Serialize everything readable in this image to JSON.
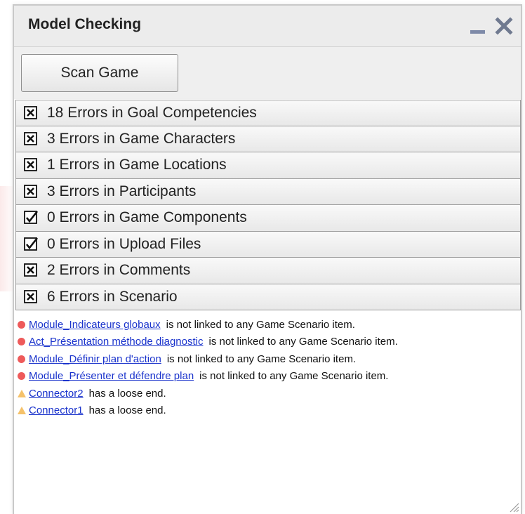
{
  "window": {
    "title": "Model Checking",
    "minimize_icon": "minimize-icon",
    "close_icon": "close-icon"
  },
  "toolbar": {
    "scan_label": "Scan Game"
  },
  "colors": {
    "error_dot": "#ee5a5a",
    "warning_triangle": "#f5c26b",
    "link": "#1a33cc",
    "section_bg": "#efefef"
  },
  "sections": [
    {
      "label": "18 Errors in Goal Competencies",
      "status": "error",
      "icon": "checkbox-x-icon"
    },
    {
      "label": "3 Errors in Game Characters",
      "status": "error",
      "icon": "checkbox-x-icon"
    },
    {
      "label": "1 Errors in Game Locations",
      "status": "error",
      "icon": "checkbox-x-icon"
    },
    {
      "label": "3 Errors in Participants",
      "status": "error",
      "icon": "checkbox-x-icon"
    },
    {
      "label": "0 Errors in Game Components",
      "status": "ok",
      "icon": "checkbox-check-icon"
    },
    {
      "label": "0 Errors in Upload Files",
      "status": "ok",
      "icon": "checkbox-check-icon"
    },
    {
      "label": "2 Errors in Comments",
      "status": "error",
      "icon": "checkbox-x-icon"
    },
    {
      "label": "6 Errors in Scenario",
      "status": "error",
      "icon": "checkbox-x-icon"
    }
  ],
  "issues": [
    {
      "severity": "error",
      "link": "Module_Indicateurs globaux",
      "message": "is not linked to any Game Scenario item."
    },
    {
      "severity": "error",
      "link": "Act_Présentation méthode diagnostic",
      "message": "is not linked to any Game Scenario item."
    },
    {
      "severity": "error",
      "link": "Module_Définir plan d'action",
      "message": "is not linked to any Game Scenario item."
    },
    {
      "severity": "error",
      "link": "Module_Présenter et défendre plan",
      "message": "is not linked to any Game Scenario item."
    },
    {
      "severity": "warning",
      "link": "Connector2",
      "message": "has a loose end."
    },
    {
      "severity": "warning",
      "link": "Connector1",
      "message": "has a loose end."
    }
  ]
}
